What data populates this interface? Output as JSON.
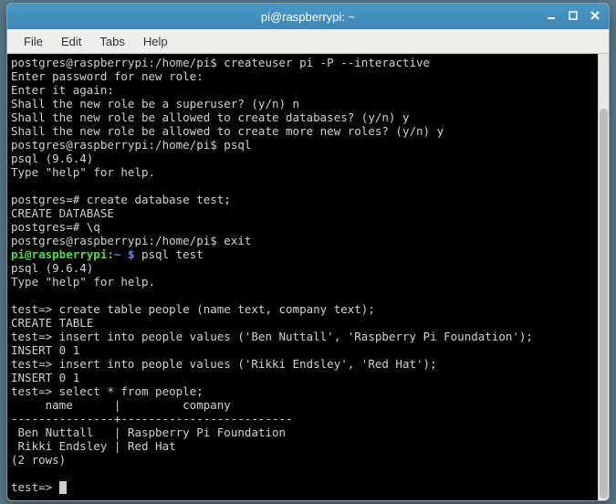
{
  "window": {
    "title": "pi@raspberrypi: ~"
  },
  "menu": {
    "file": "File",
    "edit": "Edit",
    "tabs": "Tabs",
    "help": "Help"
  },
  "term": {
    "l01_prompt": "postgres@raspberrypi:/home/pi$ ",
    "l01_cmd": "createuser pi -P --interactive",
    "l02": "Enter password for new role:",
    "l03": "Enter it again:",
    "l04": "Shall the new role be a superuser? (y/n) n",
    "l05": "Shall the new role be allowed to create databases? (y/n) y",
    "l06": "Shall the new role be allowed to create more new roles? (y/n) y",
    "l07_prompt": "postgres@raspberrypi:/home/pi$ ",
    "l07_cmd": "psql",
    "l08": "psql (9.6.4)",
    "l09": "Type \"help\" for help.",
    "blank1": "",
    "l10": "postgres=# create database test;",
    "l11": "CREATE DATABASE",
    "l12": "postgres=# \\q",
    "l13_prompt": "postgres@raspberrypi:/home/pi$ ",
    "l13_cmd": "exit",
    "l14_user": "pi@raspberrypi",
    "l14_colon": ":",
    "l14_path": "~ $",
    "l14_cmd": " psql test",
    "l15": "psql (9.6.4)",
    "l16": "Type \"help\" for help.",
    "blank2": "",
    "l17": "test=> create table people (name text, company text);",
    "l18": "CREATE TABLE",
    "l19": "test=> insert into people values ('Ben Nuttall', 'Raspberry Pi Foundation');",
    "l20": "INSERT 0 1",
    "l21": "test=> insert into people values ('Rikki Endsley', 'Red Hat');",
    "l22": "INSERT 0 1",
    "l23": "test=> select * from people;",
    "l24": "     name      |         company",
    "l25": "---------------+-------------------------",
    "l26": " Ben Nuttall   | Raspberry Pi Foundation",
    "l27": " Rikki Endsley | Red Hat",
    "l28": "(2 rows)",
    "blank3": "",
    "l29_prompt": "test=> "
  }
}
